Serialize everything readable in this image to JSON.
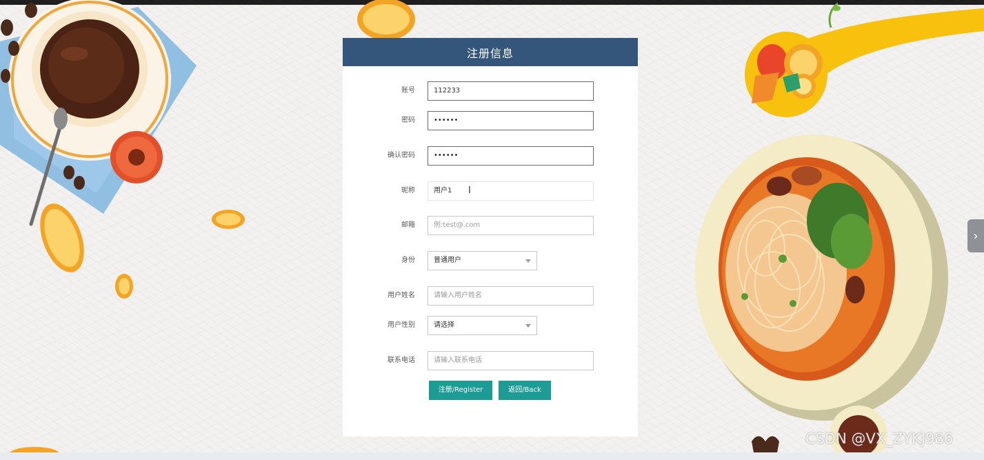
{
  "form": {
    "title": "注册信息",
    "fields": [
      {
        "label": "账号",
        "value": "112233"
      },
      {
        "label": "密码",
        "value": "••••••"
      },
      {
        "label": "确认密码",
        "value": "••••••"
      },
      {
        "label": "昵称",
        "value": "用户1"
      },
      {
        "label": "邮箱",
        "placeholder": "例:test@.com"
      },
      {
        "label": "身份",
        "selected": "普通用户"
      },
      {
        "label": "用户姓名",
        "placeholder": "请输入用户姓名"
      },
      {
        "label": "用户性别",
        "selected": "请选择"
      },
      {
        "label": "联系电话",
        "placeholder": "请输入联系电话"
      }
    ],
    "buttons": {
      "register": "注册/Register",
      "back": "返回/Back"
    }
  },
  "side_nav": {
    "icon": "chevron-right-icon",
    "glyph": "›"
  },
  "watermark": "CSDN @VX_ZYKJ986",
  "colors": {
    "header": "#34567a",
    "button": "#1d9b95"
  }
}
